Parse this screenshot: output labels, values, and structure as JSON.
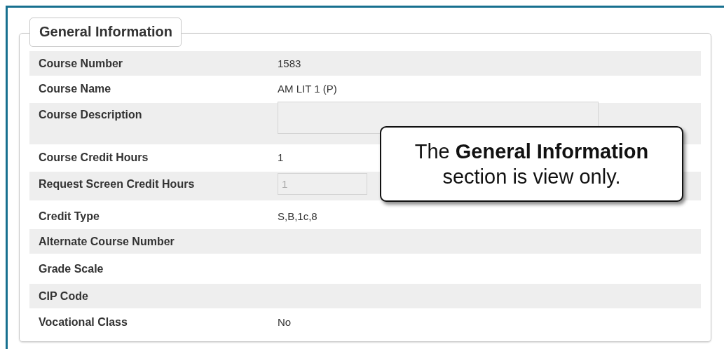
{
  "section": {
    "title": "General Information"
  },
  "fields": [
    {
      "label": "Course Number",
      "kind": "text",
      "value": "1583"
    },
    {
      "label": "Course Name",
      "kind": "text",
      "value": "AM LIT 1 (P)"
    },
    {
      "label": "Course Description",
      "kind": "textarea",
      "disabled": true
    },
    {
      "label": "Course Credit Hours",
      "kind": "text",
      "value": "1"
    },
    {
      "label": "Request Screen Credit Hours",
      "kind": "input",
      "value": "1",
      "disabled": true
    },
    {
      "label": "Credit Type",
      "kind": "text",
      "value": "S,B,1c,8"
    },
    {
      "label": "Alternate Course Number",
      "kind": "text"
    },
    {
      "label": "Grade Scale",
      "kind": "text"
    },
    {
      "label": "CIP Code",
      "kind": "text"
    },
    {
      "label": "Vocational Class",
      "kind": "text",
      "value": "No"
    }
  ],
  "callout": {
    "text": "The **General Information** section is view only."
  }
}
